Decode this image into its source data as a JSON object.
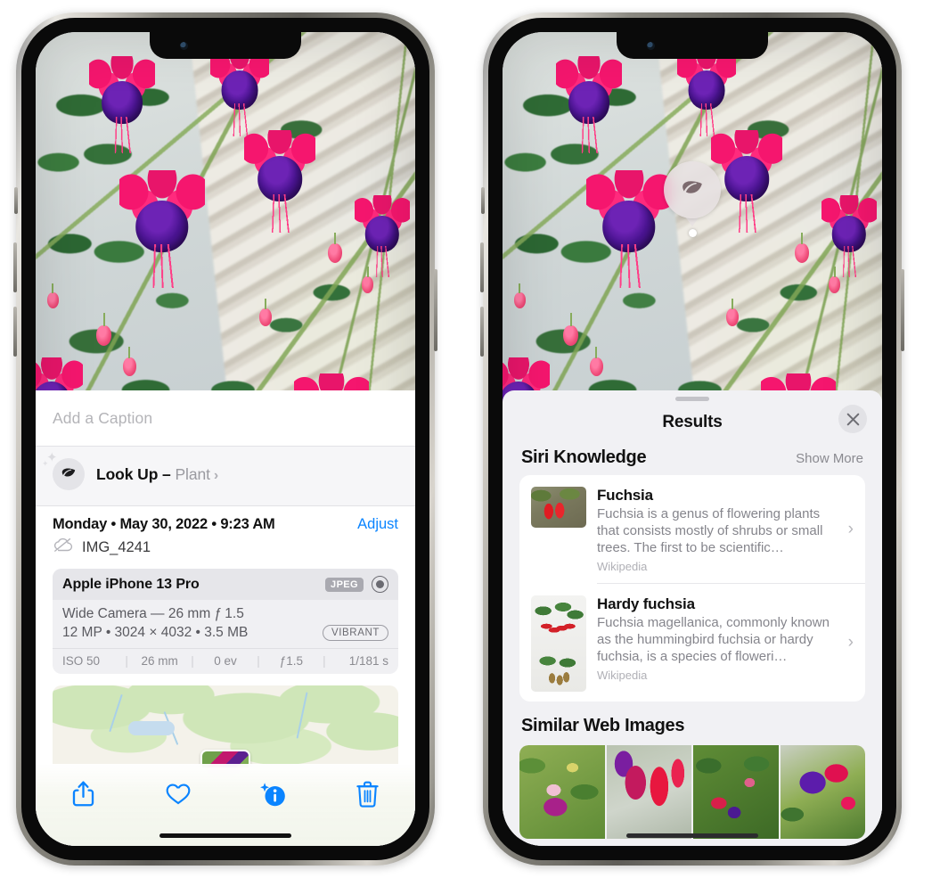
{
  "left_phone": {
    "caption_placeholder": "Add a Caption",
    "lookup": {
      "icon": "leaf-icon",
      "label": "Look Up – ",
      "subject": "Plant",
      "chevron": "›"
    },
    "metadata": {
      "date_line": "Monday • May 30, 2022 • 9:23 AM",
      "adjust_label": "Adjust",
      "cloud_icon": "cloud-slash-icon",
      "filename": "IMG_4241"
    },
    "camera_card": {
      "device": "Apple iPhone 13 Pro",
      "format_tag": "JPEG",
      "raw_icon": "raw-circle-icon",
      "lens_line": "Wide Camera — 26 mm ƒ 1.5",
      "size_line": "12 MP • 3024 × 4032 • 3.5 MB",
      "profile_tag": "VIBRANT",
      "exif": [
        {
          "label": "ISO 50"
        },
        {
          "label": "26 mm"
        },
        {
          "label": "0 ev"
        },
        {
          "label": "ƒ1.5"
        },
        {
          "label": "1/181 s"
        }
      ],
      "separator": "|"
    },
    "map_card": {
      "thumbnail_name": "photo-location-thumbnail"
    },
    "toolbar": [
      {
        "name": "share-button",
        "icon": "share-icon"
      },
      {
        "name": "favorite-button",
        "icon": "heart-icon"
      },
      {
        "name": "info-button",
        "icon": "info-sparkle-icon"
      },
      {
        "name": "delete-button",
        "icon": "trash-icon"
      }
    ]
  },
  "right_phone": {
    "visual_lookup_badge": {
      "icon": "leaf-icon",
      "name": "visual-lookup-badge"
    },
    "sheet": {
      "title": "Results",
      "close_icon": "close-icon",
      "grabber": "drag-handle"
    },
    "siri_knowledge": {
      "section_title": "Siri Knowledge",
      "show_more": "Show More",
      "items": [
        {
          "title": "Fuchsia",
          "description": "Fuchsia is a genus of flowering plants that consists mostly of shrubs or small trees. The first to be scientific…",
          "source": "Wikipedia",
          "chevron": "›",
          "thumbnail_name": "fuchsia-thumbnail"
        },
        {
          "title": "Hardy fuchsia",
          "description": "Fuchsia magellanica, commonly known as the hummingbird fuchsia or hardy fuchsia, is a species of floweri…",
          "source": "Wikipedia",
          "chevron": "›",
          "thumbnail_name": "hardy-fuchsia-thumbnail"
        }
      ]
    },
    "similar_web_images": {
      "section_title": "Similar Web Images",
      "items": [
        {
          "name": "similar-image-1"
        },
        {
          "name": "similar-image-2"
        },
        {
          "name": "similar-image-3"
        },
        {
          "name": "similar-image-4"
        }
      ]
    }
  },
  "colors": {
    "accent_blue": "#0a84ff",
    "sheet_gray": "#f1f1f4",
    "card_white": "#ffffff",
    "secondary_text": "#85858c",
    "title_text": "#111111"
  }
}
